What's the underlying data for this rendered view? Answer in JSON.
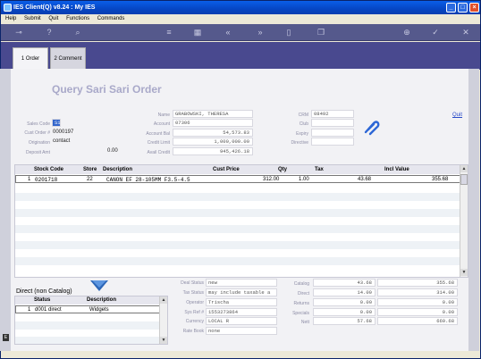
{
  "window": {
    "title": "IES Client(Q) v8.24 : My IES"
  },
  "menu": [
    "Help",
    "Submit",
    "Quit",
    "Functions",
    "Commands"
  ],
  "tabs": [
    {
      "label": "1 Order"
    },
    {
      "label": "2 Comment"
    }
  ],
  "page": {
    "title": "Query Sari Sari Order",
    "link": "Quit"
  },
  "left_fields": {
    "sales_code": {
      "label": "Sales Code",
      "value": "S1"
    },
    "cust_order": {
      "label": "Cust Order #",
      "value": "0000197"
    },
    "origination": {
      "label": "Origination",
      "value": "contact"
    },
    "deposit": {
      "label": "Deposit Amt",
      "value": "0.00"
    }
  },
  "mid_fields": {
    "name": {
      "label": "Name",
      "value": "GRABOWSKI, THERESA"
    },
    "account": {
      "label": "Account",
      "value": "07306"
    },
    "account_bal": {
      "label": "Account Bal",
      "value": "54,573.83"
    },
    "credit_limit": {
      "label": "Credit Limit",
      "value": "1,000,000.00"
    },
    "avail_credit": {
      "label": "Avail Credit",
      "value": "945,426.18"
    }
  },
  "right_fields": {
    "crm": {
      "label": "CRM",
      "value": "08492"
    },
    "club": {
      "label": "Club",
      "value": ""
    },
    "expiry": {
      "label": "Expiry",
      "value": ""
    },
    "directive": {
      "label": "Directive",
      "value": ""
    }
  },
  "lines": {
    "headers": [
      "Stock Code",
      "Store",
      "Description",
      "Cust Price",
      "Qty",
      "Tax",
      "Incl Value"
    ],
    "rows": [
      {
        "num": "1",
        "stock": "0201718",
        "store": "22",
        "desc": "CANON EF 28-105MM F3.5-4.5",
        "price": "312.00",
        "qty": "1.00",
        "tax": "43.68",
        "incl": "355.68"
      }
    ]
  },
  "direct": {
    "title": "Direct (non Catalog)",
    "headers": [
      "Status",
      "Description"
    ],
    "rows": [
      {
        "num": "1",
        "status": "d001 direct",
        "desc": "Widgets"
      }
    ]
  },
  "status_fields": {
    "deal_status": {
      "label": "Deal Status",
      "value": "new"
    },
    "tax_status": {
      "label": "Tax Status",
      "value": "may include taxable a"
    },
    "operator": {
      "label": "Operator",
      "value": "Trischa"
    },
    "sys_ref": {
      "label": "Sys Ref #",
      "value": "1553273864"
    },
    "currency": {
      "label": "Currency",
      "value": "LOCAL R"
    },
    "rate_book": {
      "label": "Rate Book",
      "value": "none"
    }
  },
  "totals": {
    "catalog": {
      "label": "Catalog",
      "tax": "43.68",
      "value": "355.68"
    },
    "direct": {
      "label": "Direct",
      "tax": "14.00",
      "value": "314.00"
    },
    "returns": {
      "label": "Returns",
      "tax": "0.00",
      "value": "0.00"
    },
    "specials": {
      "label": "Specials",
      "tax": "0.00",
      "value": "0.00"
    },
    "nett": {
      "label": "Nett",
      "tax": "57.68",
      "value": "669.68"
    }
  }
}
